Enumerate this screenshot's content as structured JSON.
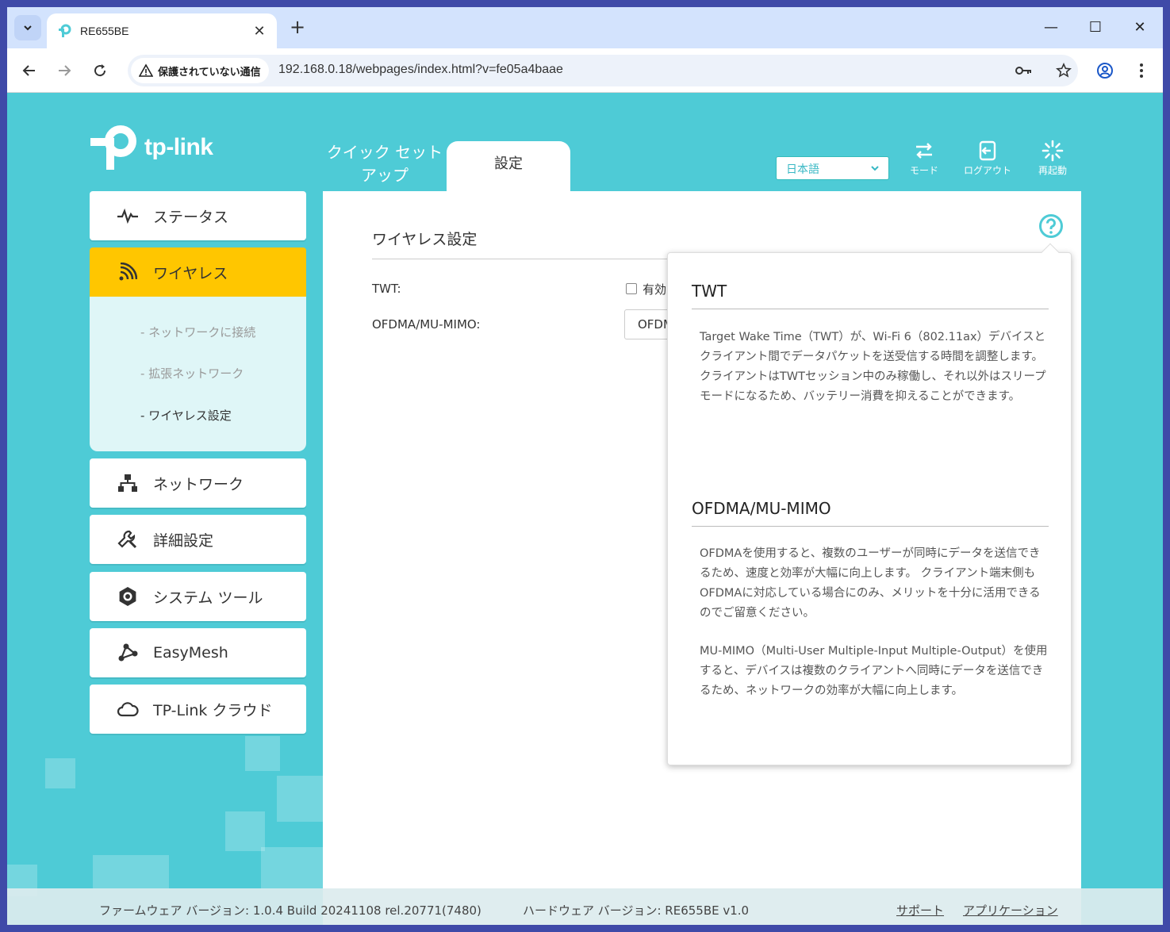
{
  "browser": {
    "tab_title": "RE655BE",
    "security_label": "保護されていない通信",
    "url": "192.168.0.18/webpages/index.html?v=fe05a4baae"
  },
  "header": {
    "logo_text": "tp-link",
    "nav_quick_setup": "クイック セット アップ",
    "nav_settings": "設定",
    "language": "日本語",
    "mode_label": "モード",
    "logout_label": "ログアウト",
    "reboot_label": "再起動"
  },
  "sidebar": {
    "items": [
      {
        "label": "ステータス",
        "icon": "pulse-icon"
      },
      {
        "label": "ワイヤレス",
        "icon": "wifi-icon"
      },
      {
        "label": "ネットワーク",
        "icon": "network-icon"
      },
      {
        "label": "詳細設定",
        "icon": "wrench-icon"
      },
      {
        "label": "システム ツール",
        "icon": "gear-icon"
      },
      {
        "label": "EasyMesh",
        "icon": "mesh-icon"
      },
      {
        "label": "TP-Link クラウド",
        "icon": "cloud-icon"
      }
    ],
    "sub_items": [
      "ネットワークに接続",
      "拡張ネットワーク",
      "ワイヤレス設定"
    ]
  },
  "content": {
    "section_title": "ワイヤレス設定",
    "twt_label": "TWT:",
    "twt_checkbox_label": "有効",
    "twt_checked": false,
    "ofdma_label": "OFDMA/MU-MIMO:",
    "ofdma_value": "OFDMA"
  },
  "help": {
    "twt_title": "TWT",
    "twt_text": "Target Wake Time（TWT）が、Wi-Fi 6（802.11ax）デバイスとクライアント間でデータパケットを送受信する時間を調整します。クライアントはTWTセッション中のみ稼働し、それ以外はスリープモードになるため、バッテリー消費を抑えることができます。",
    "ofdma_title": "OFDMA/MU-MIMO",
    "ofdma_text": "OFDMAを使用すると、複数のユーザーが同時にデータを送信できるため、速度と効率が大幅に向上します。 クライアント端末側もOFDMAに対応している場合にのみ、メリットを十分に活用できるのでご留意ください。",
    "mumimo_text": "MU-MIMO（Multi-User Multiple-Input Multiple-Output）を使用すると、デバイスは複数のクライアントへ同時にデータを送信できるため、ネットワークの効率が大幅に向上します。"
  },
  "footer": {
    "firmware": "ファームウェア バージョン: 1.0.4 Build 20241108 rel.20771(7480)",
    "hardware": "ハードウェア バージョン: RE655BE v1.0",
    "support_link": "サポート",
    "app_link": "アプリケーション"
  },
  "colors": {
    "page_bg": "#4ecbd6",
    "active_item": "#ffc600",
    "submenu_bg": "#dff6f7"
  }
}
